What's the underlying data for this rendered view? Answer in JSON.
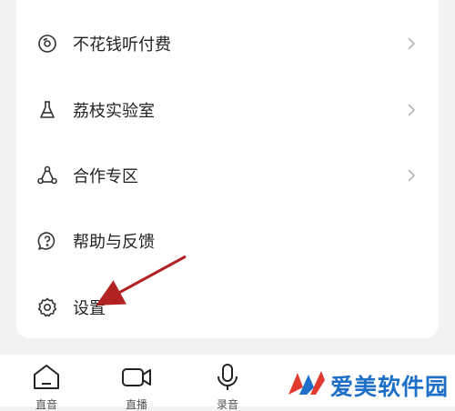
{
  "menu": {
    "items": [
      {
        "label": "不花钱听付费",
        "icon": "disc-icon",
        "has_chevron": true
      },
      {
        "label": "荔枝实验室",
        "icon": "flask-icon",
        "has_chevron": true
      },
      {
        "label": "合作专区",
        "icon": "cooperation-icon",
        "has_chevron": true
      },
      {
        "label": "帮助与反馈",
        "icon": "help-chat-icon",
        "has_chevron": false
      },
      {
        "label": "设置",
        "icon": "gear-icon",
        "has_chevron": false
      }
    ]
  },
  "tabbar": {
    "tabs": [
      {
        "label": "直音",
        "icon": "home-icon"
      },
      {
        "label": "直播",
        "icon": "video-camera-icon"
      },
      {
        "label": "录音",
        "icon": "microphone-icon"
      }
    ]
  },
  "annotation": {
    "color": "#b22222",
    "points_to": "设置"
  },
  "watermark": {
    "text": "爱美软件园",
    "color": "#1e6fc7"
  }
}
